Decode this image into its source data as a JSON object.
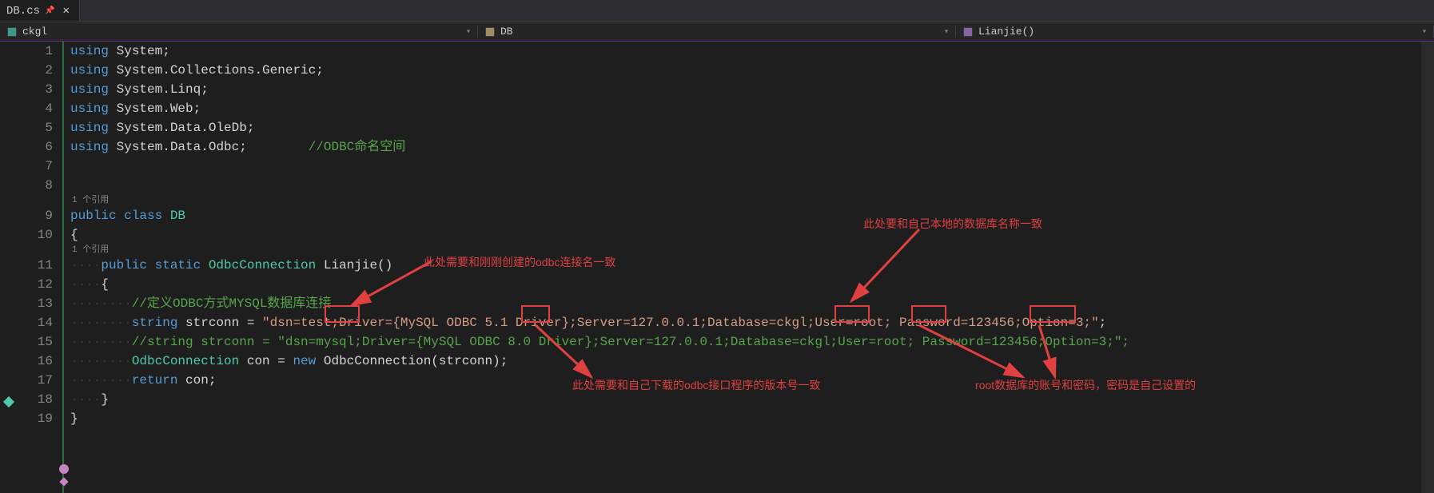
{
  "tab": {
    "filename": "DB.cs",
    "pinned": true
  },
  "nav": {
    "namespace": "ckgl",
    "class": "DB",
    "method": "Lianjie()"
  },
  "codelens": {
    "class_refs": "1 个引用",
    "method_refs": "1 个引用"
  },
  "lines": {
    "1": "1",
    "2": "2",
    "3": "3",
    "4": "4",
    "5": "5",
    "6": "6",
    "7": "7",
    "8": "8",
    "9": "9",
    "10": "10",
    "11": "11",
    "12": "12",
    "13": "13",
    "14": "14",
    "15": "15",
    "16": "16",
    "17": "17",
    "18": "18",
    "19": "19"
  },
  "code": {
    "using": "using",
    "ns_system": " System;",
    "ns_collections": " System.Collections.Generic;",
    "ns_linq": " System.Linq;",
    "ns_web": " System.Web;",
    "ns_oledb": " System.Data.OleDb;",
    "ns_odbc": " System.Data.Odbc;",
    "comment_odbc": "        //ODBC命名空间",
    "public": "public",
    "class": " class ",
    "db": "DB",
    "brace_open": "{",
    "brace_close": "}",
    "indent1": "    ",
    "indent2": "        ",
    "static": " static ",
    "odbcconn": "OdbcConnection",
    "lianjie": " Lianjie()",
    "comment_define": "//定义ODBC方式MYSQL数据库连接",
    "string": "string",
    "strconn_var": " strconn = ",
    "strconn_val": "\"dsn=test;Driver={MySQL ODBC 5.1 Driver};Server=127.0.0.1;Database=ckgl;User=root; Password=123456;Option=3;\"",
    "semicolon": ";",
    "comment_strconn": "//string strconn = \"dsn=mysql;Driver={MySQL ODBC 8.0 Driver};Server=127.0.0.1;Database=ckgl;User=root; Password=123456;Option=3;\";",
    "con_var": " con = ",
    "new": "new",
    "odbcconn_call": " OdbcConnection(strconn);",
    "return": "return",
    "con": " con;",
    "dots4": "····",
    "dots8": "········"
  },
  "annotations": {
    "a1": "此处需要和刚刚创建的odbc连接名一致",
    "a2": "此处要和自己本地的数据库名称一致",
    "a3": "此处需要和自己下载的odbc接口程序的版本号一致",
    "a4": "root数据库的账号和密码，密码是自己设置的"
  }
}
